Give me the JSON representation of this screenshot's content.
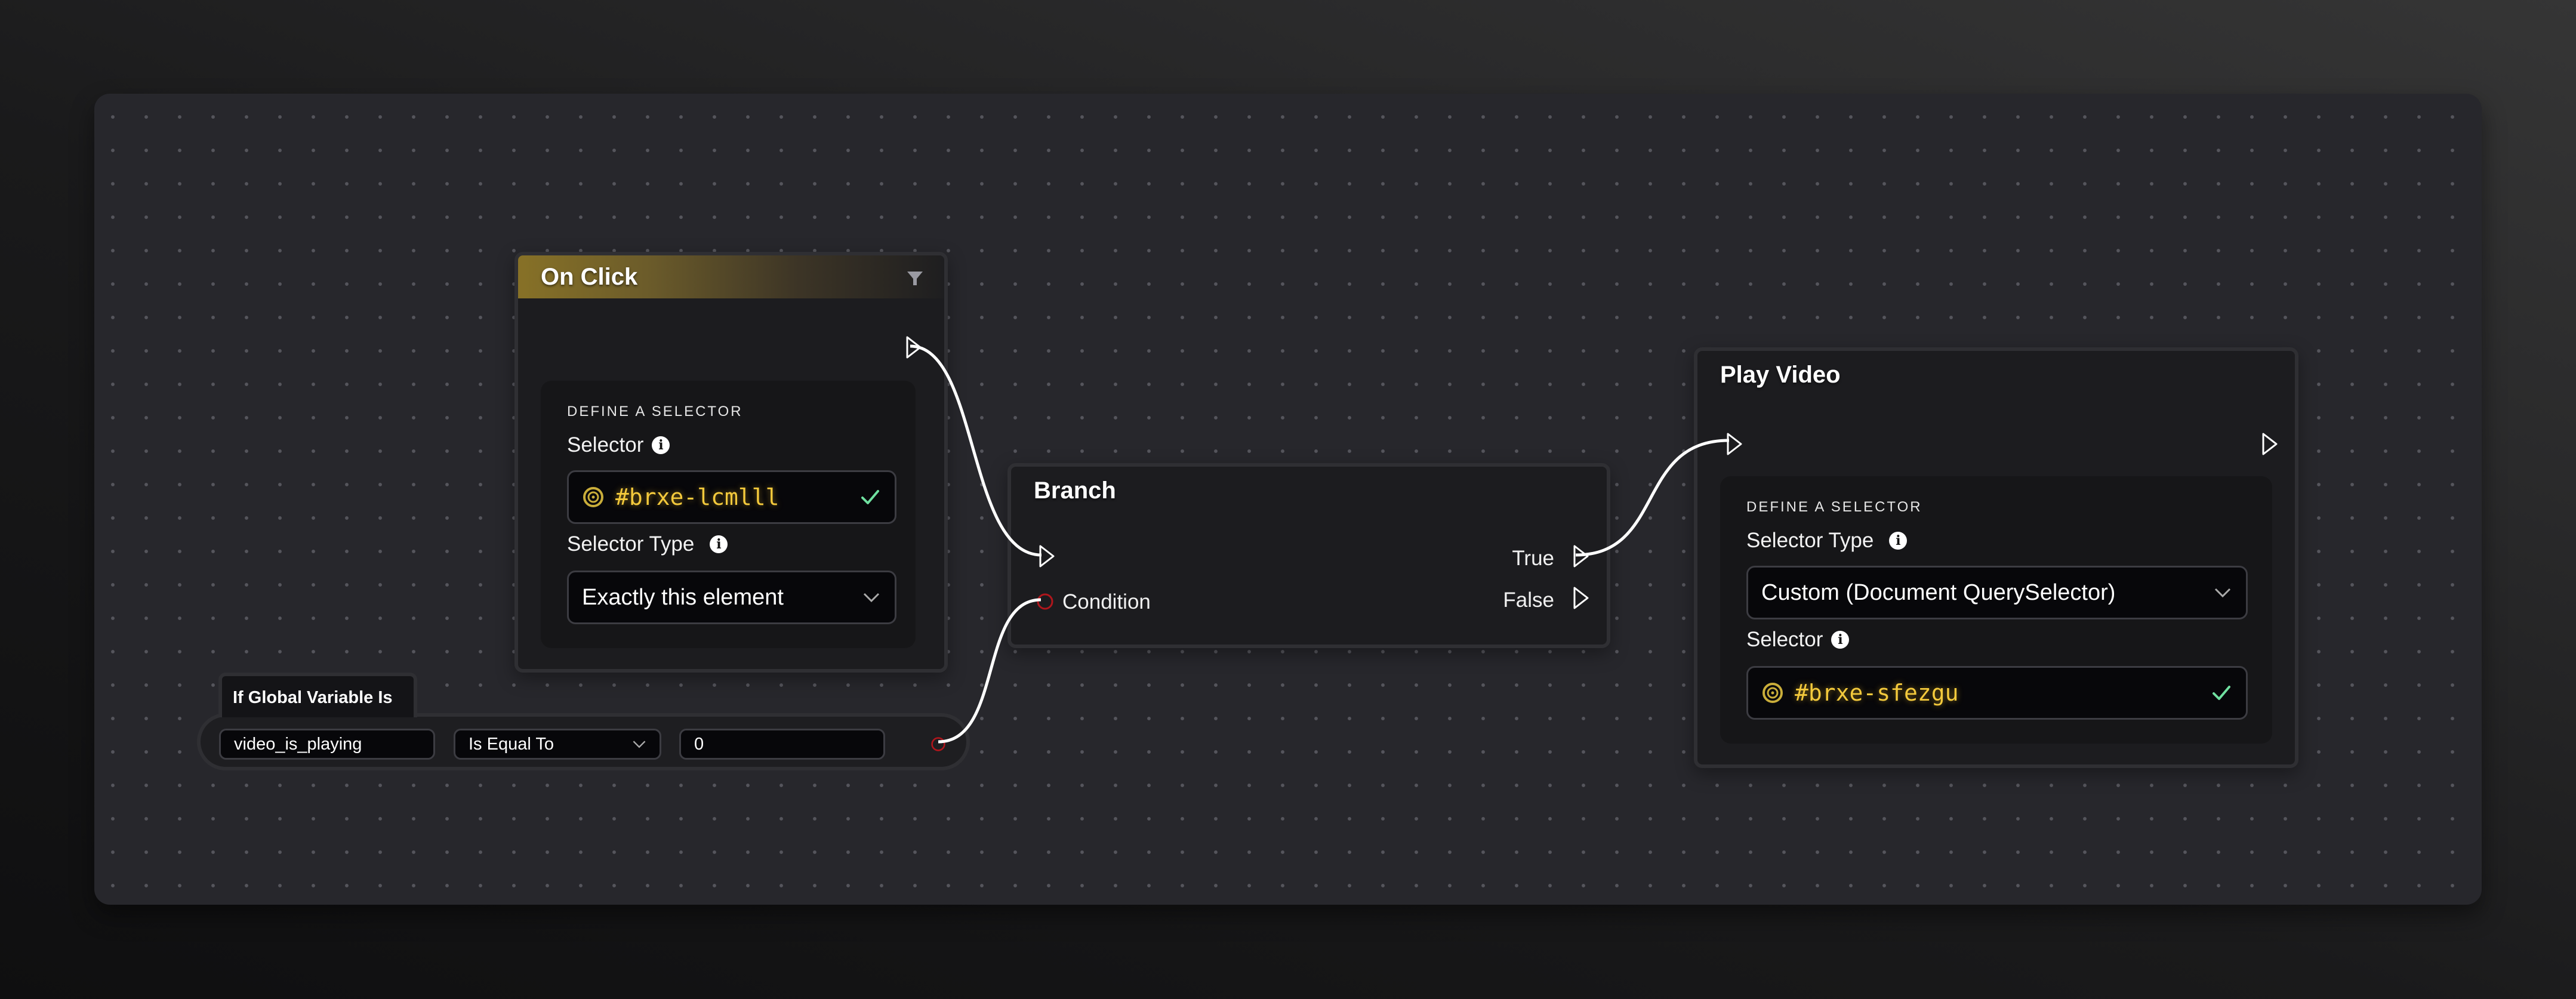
{
  "nodes": {
    "on_click": {
      "title": "On Click",
      "header_color": "#877127",
      "filter_icon": "filter-icon",
      "selector_panel": {
        "heading": "DEFINE A SELECTOR",
        "selector_label": "Selector",
        "selector_value": "#brxe-lcmlll",
        "selector_valid": true,
        "selector_type_label": "Selector Type",
        "selector_type_value": "Exactly this element"
      }
    },
    "branch": {
      "title": "Branch",
      "inputs": [
        "exec",
        "Condition"
      ],
      "condition_label": "Condition",
      "outputs": [
        "True",
        "False"
      ],
      "true_label": "True",
      "false_label": "False"
    },
    "play_video": {
      "title": "Play Video",
      "selector_panel": {
        "heading": "DEFINE A SELECTOR",
        "selector_type_label": "Selector Type",
        "selector_type_value": "Custom (Document QuerySelector)",
        "selector_label": "Selector",
        "selector_value": "#brxe-sfezgu",
        "selector_valid": true
      }
    },
    "global_variable": {
      "title": "If Global Variable Is",
      "variable_name": "video_is_playing",
      "operator": "Is Equal To",
      "compare_value": "0"
    }
  },
  "connections": [
    {
      "from": "On Click.exec_out",
      "to": "Branch.exec_in"
    },
    {
      "from": "If Global Variable Is.out",
      "to": "Branch.Condition"
    },
    {
      "from": "Branch.True",
      "to": "Play Video.exec_in"
    }
  ],
  "colors": {
    "accent_gold": "#f3c93c",
    "valid_check": "#6fe0a0",
    "condition_port": "#b0161c",
    "wire": "#ffffff"
  }
}
